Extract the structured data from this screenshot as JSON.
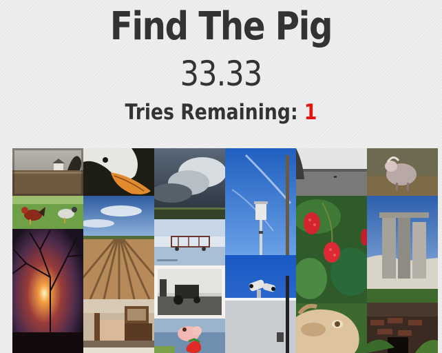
{
  "header": {
    "title": "Find The Pig",
    "score": "33.33",
    "tries_label": "Tries Remaining: ",
    "tries_count": "1"
  },
  "colors": {
    "text": "#333333",
    "tries_count": "#e2140f",
    "background": "#ececec"
  },
  "tiles": [
    {
      "name": "tile-farmhouse-field"
    },
    {
      "name": "tile-duck-beak"
    },
    {
      "name": "tile-storm-clouds"
    },
    {
      "name": "tile-pole-sky"
    },
    {
      "name": "tile-grey-field"
    },
    {
      "name": "tile-sheep"
    },
    {
      "name": "tile-chickens"
    },
    {
      "name": "tile-plowed-field"
    },
    {
      "name": "tile-wagon-flood"
    },
    {
      "name": "tile-raspberries"
    },
    {
      "name": "tile-stone-monument"
    },
    {
      "name": "tile-sunset-tree"
    },
    {
      "name": "tile-old-tractor"
    },
    {
      "name": "tile-security-cameras"
    },
    {
      "name": "tile-bedroom"
    },
    {
      "name": "tile-pig-strawberry"
    },
    {
      "name": "tile-goat-face"
    },
    {
      "name": "tile-brick-ruins"
    }
  ]
}
